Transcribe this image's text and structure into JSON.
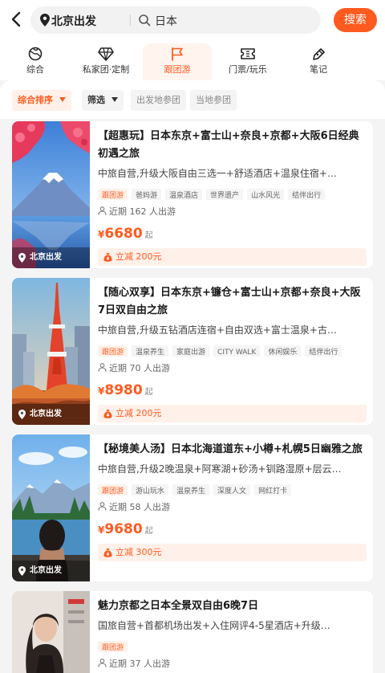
{
  "search": {
    "location": "北京出发",
    "query": "日本",
    "button": "搜索"
  },
  "tabs": [
    {
      "label": "综合",
      "icon": "globe-icon"
    },
    {
      "label": "私家团·定制",
      "icon": "diamond-icon"
    },
    {
      "label": "跟团游",
      "icon": "flag-icon",
      "active": true
    },
    {
      "label": "门票/玩乐",
      "icon": "ticket-icon"
    },
    {
      "label": "笔记",
      "icon": "pen-icon"
    }
  ],
  "filters": {
    "sort": "综合排序",
    "filter": "筛选",
    "origin_group": "出发地参团",
    "local_group": "当地参团"
  },
  "products": [
    {
      "title": "【超惠玩】日本东京+富士山+奈良+京都+大阪6日经典初遇之旅",
      "subtitle": "中旅自营,升级大阪自由三选一+舒适酒店+温泉住宿+…",
      "tags": [
        "跟团游",
        "爸妈游",
        "温泉酒店",
        "世界遗产",
        "山水风光",
        "结伴出行"
      ],
      "visits": "近期 162 人出游",
      "currency": "¥",
      "price": "6680",
      "price_suffix": "起",
      "coupon": "立减 200元",
      "origin": "北京出发"
    },
    {
      "title": "【随心双享】日本东京+镰仓+富士山+京都+奈良+大阪7日双自由之旅",
      "subtitle": "中旅自营,升级五钻酒店连宿+自由双选+富士温泉+古…",
      "tags": [
        "跟团游",
        "温泉养生",
        "家庭出游",
        "CITY WALK",
        "休闲娱乐",
        "结伴出行"
      ],
      "visits": "近期 70 人出游",
      "currency": "¥",
      "price": "8980",
      "price_suffix": "起",
      "coupon": "立减 200元",
      "origin": "北京出发"
    },
    {
      "title": "【秘境美人汤】日本北海道道东+小樽+札幌5日幽雅之旅",
      "subtitle": "中旅自营,升级2晚温泉+阿寒湖+砂汤+钏路湿原+层云…",
      "tags": [
        "跟团游",
        "游山玩水",
        "温泉养生",
        "深度人文",
        "网红打卡"
      ],
      "visits": "近期 58 人出游",
      "currency": "¥",
      "price": "9680",
      "price_suffix": "起",
      "coupon": "立减 300元",
      "origin": "北京出发"
    },
    {
      "title": "魅力京都之日本全景双自由6晚7日",
      "subtitle": "国旅自营+首都机场出发+入住网评4-5星酒店+升级…",
      "tags": [
        "跟团游"
      ],
      "visits": "近期 37 人出游",
      "origin": ""
    }
  ],
  "colors": {
    "accent": "#ff5a1f",
    "coupon_bg": "#fff1ea",
    "page_bg": "#f4f4f4"
  }
}
